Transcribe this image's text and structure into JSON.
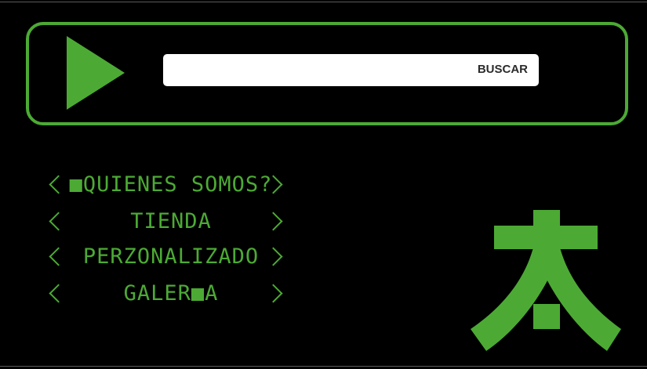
{
  "colors": {
    "accent": "#4caa34",
    "background": "#000000",
    "search_bg": "#ffffff"
  },
  "header": {
    "play_icon": "play-triangle-icon",
    "search": {
      "value": "",
      "placeholder": "",
      "button_label": "BUSCAR"
    }
  },
  "menu": {
    "items": [
      {
        "label": "■QUIENES SOMOS?"
      },
      {
        "label": "TIENDA"
      },
      {
        "label": "PERZONALIZADO"
      },
      {
        "label": "GALER■A"
      }
    ]
  },
  "logo": {
    "icon": "green-glyph-logo-icon"
  }
}
